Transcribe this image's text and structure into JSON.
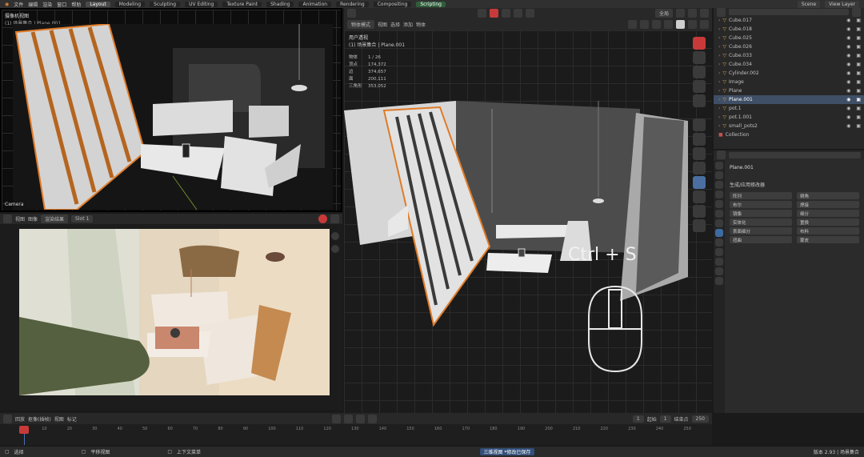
{
  "topbar": {
    "menus": [
      "文件",
      "编辑",
      "渲染",
      "窗口",
      "帮助"
    ],
    "workspaces": [
      "Layout",
      "Modeling",
      "Sculpting",
      "UV Editing",
      "Texture Paint",
      "Shading",
      "Animation",
      "Rendering",
      "Compositing",
      "Scripting"
    ],
    "active_workspace_index": 0,
    "scene_label": "Scene",
    "view_layer_label": "View Layer"
  },
  "camera_view": {
    "title": "摄像机视图",
    "subtitle": "(1) 场景集合 | Plane.001",
    "camera_label": "Camera"
  },
  "render_editor": {
    "header_items": [
      "视图",
      "图像"
    ],
    "image_name": "渲染结果",
    "slot_label": "Slot 1"
  },
  "viewport": {
    "mode": "物体模式",
    "menus": [
      "视图",
      "选择",
      "添加",
      "物体"
    ],
    "orientation": "全局",
    "info_title": "用户透视",
    "info_subtitle": "(1) 场景集合 | Plane.001",
    "stats": [
      {
        "label": "物体",
        "value": "1 / 26"
      },
      {
        "label": "顶点",
        "value": "174,372"
      },
      {
        "label": "边",
        "value": "374,657"
      },
      {
        "label": "面",
        "value": "200,111"
      },
      {
        "label": "三角形",
        "value": "353,052"
      }
    ],
    "shortcut_overlay": "Ctrl + S"
  },
  "outliner": {
    "search_placeholder": "",
    "items": [
      {
        "name": "Cube.017",
        "selected": false
      },
      {
        "name": "Cube.018",
        "selected": false
      },
      {
        "name": "Cube.025",
        "selected": false
      },
      {
        "name": "Cube.026",
        "selected": false
      },
      {
        "name": "Cube.033",
        "selected": false
      },
      {
        "name": "Cube.034",
        "selected": false
      },
      {
        "name": "Cylinder.002",
        "selected": false
      },
      {
        "name": "Image",
        "selected": false
      },
      {
        "name": "Plane",
        "selected": false
      },
      {
        "name": "Plane.001",
        "selected": true
      },
      {
        "name": "pot.1",
        "selected": false
      },
      {
        "name": "pot.1.001",
        "selected": false
      },
      {
        "name": "small_pots2",
        "selected": false
      }
    ],
    "collection_label": "Collection"
  },
  "properties": {
    "object_name": "Plane.001",
    "panel_title": "生成/应用修改器",
    "buttons": [
      "阵列",
      "倒角",
      "布尔",
      "焊接",
      "镜像",
      "细分",
      "实体化",
      "置换",
      "表面细分",
      "布料",
      "扭曲",
      "蒙皮"
    ]
  },
  "timeline": {
    "menus": [
      "回放",
      "抠像(插帧)",
      "视图",
      "标记"
    ],
    "current_frame": "1",
    "start_label": "起始",
    "start_value": "1",
    "end_label": "结束点",
    "end_value": "250",
    "ticks": [
      "0",
      "10",
      "20",
      "30",
      "40",
      "50",
      "60",
      "70",
      "80",
      "90",
      "100",
      "110",
      "120",
      "130",
      "140",
      "150",
      "160",
      "170",
      "180",
      "190",
      "200",
      "210",
      "220",
      "230",
      "240",
      "250"
    ]
  },
  "statusbar": {
    "left": [
      "选择",
      "平移视图",
      "上下文菜单"
    ],
    "center": "三维视图 *修改已保存",
    "right": "版本 2.93 | 场景集合"
  },
  "colors": {
    "accent": "#e0873a",
    "selected_row": "#3f4f66",
    "panel": "#303030"
  }
}
